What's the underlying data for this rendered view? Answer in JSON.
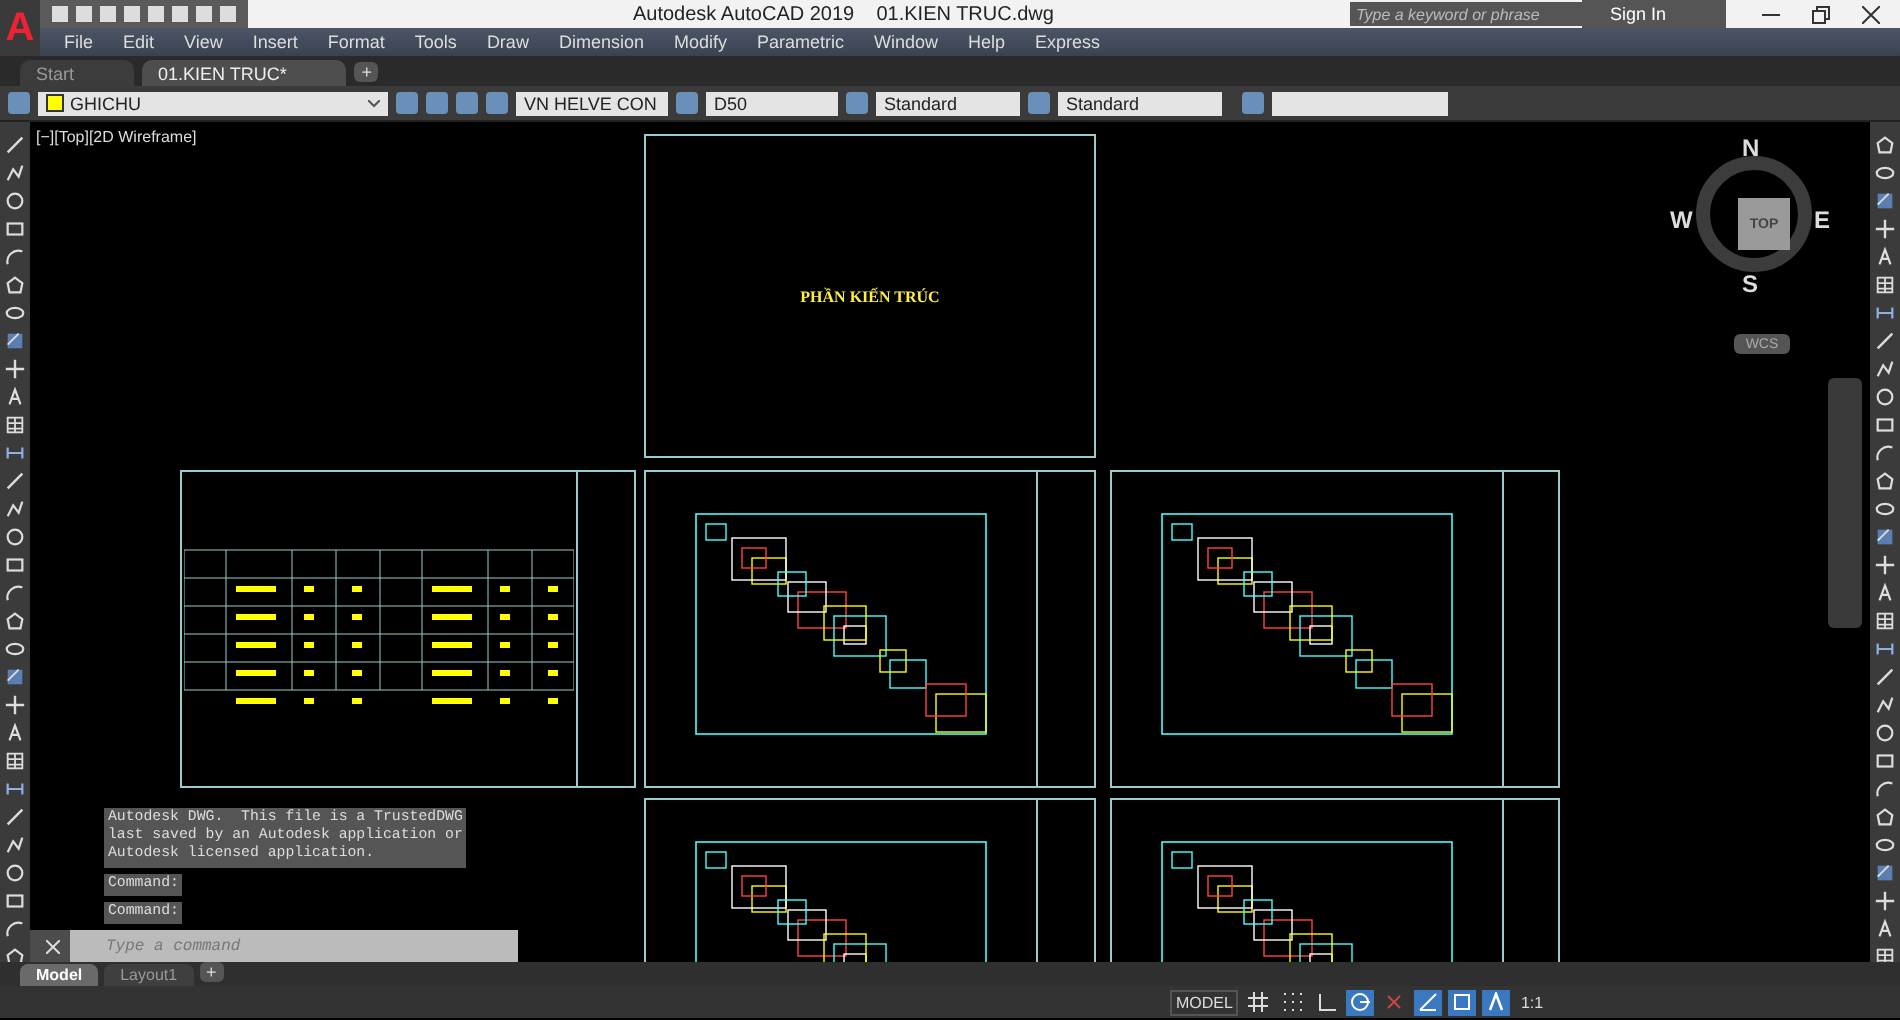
{
  "app_button": {
    "label": "A"
  },
  "window": {
    "title": "Autodesk AutoCAD 2019",
    "file": "01.KIEN TRUC.dwg"
  },
  "search": {
    "placeholder": "Type a keyword or phrase"
  },
  "sign_in": "Sign In",
  "menu": [
    "File",
    "Edit",
    "View",
    "Insert",
    "Format",
    "Tools",
    "Draw",
    "Dimension",
    "Modify",
    "Parametric",
    "Window",
    "Help",
    "Express"
  ],
  "file_tabs": [
    {
      "label": "Start",
      "selected": false
    },
    {
      "label": "01.KIEN TRUC*",
      "selected": true
    }
  ],
  "new_tab": "+",
  "toolbar": {
    "layer": "GHICHU",
    "text_style": "VN HELVE CON",
    "dim_style": "D50",
    "table_style": "Standard",
    "multileader_style": "Standard"
  },
  "viewport_label": "[−][Top][2D Wireframe]",
  "viewcube": {
    "north": "N",
    "south": "S",
    "east": "E",
    "west": "W",
    "face": "TOP",
    "ucs": "WCS"
  },
  "sheets": [
    {
      "kind": "cover",
      "title": "PHẦN KIẾN TRÚC"
    },
    {
      "kind": "index"
    },
    {
      "kind": "plan"
    },
    {
      "kind": "plan"
    },
    {
      "kind": "plan"
    },
    {
      "kind": "plan"
    }
  ],
  "command_history": [
    "Autodesk DWG.  This file is a TrustedDWG\nlast saved by an Autodesk application or\nAutodesk licensed application.",
    "Command:",
    "Command:"
  ],
  "command_line": {
    "placeholder": "Type a command"
  },
  "layout_tabs": [
    {
      "label": "Model",
      "selected": true
    },
    {
      "label": "Layout1",
      "selected": false
    }
  ],
  "new_layout": "+",
  "status_bar": {
    "model": "MODEL",
    "scale": "1:1"
  },
  "status_toggles": [
    {
      "kind": "grid",
      "on": false
    },
    {
      "kind": "snap",
      "on": false
    },
    {
      "kind": "ortho",
      "on": false
    },
    {
      "kind": "polar",
      "on": true
    },
    {
      "kind": "isodraft",
      "on": false
    },
    {
      "kind": "tracking",
      "on": true
    },
    {
      "kind": "osnap",
      "on": true
    },
    {
      "kind": "annotation",
      "on": true
    }
  ]
}
